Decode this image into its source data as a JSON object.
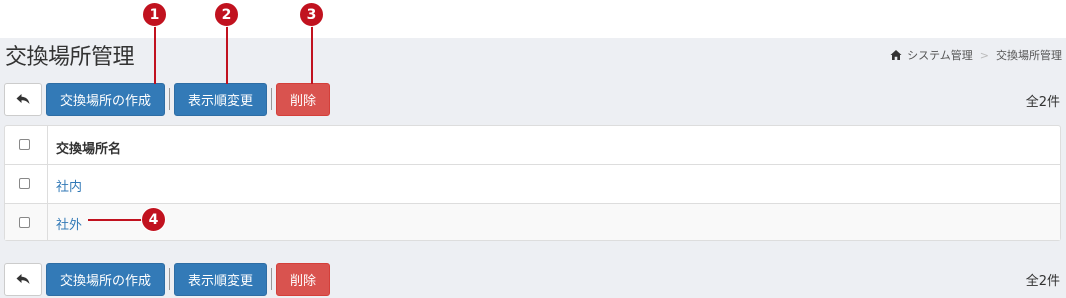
{
  "page": {
    "title": "交換場所管理"
  },
  "breadcrumb": {
    "items": [
      "システム管理",
      "交換場所管理"
    ],
    "separator": ">"
  },
  "toolbar": {
    "create_label": "交換場所の作成",
    "reorder_label": "表示順変更",
    "delete_label": "削除",
    "count": "全2件"
  },
  "table": {
    "header": "交換場所名",
    "rows": [
      {
        "name": "社内"
      },
      {
        "name": "社外"
      }
    ]
  },
  "callouts": [
    "1",
    "2",
    "3",
    "4"
  ],
  "colors": {
    "primary": "#337ab7",
    "danger": "#d9534f",
    "callout": "#c1121f",
    "link": "#337ab7"
  }
}
